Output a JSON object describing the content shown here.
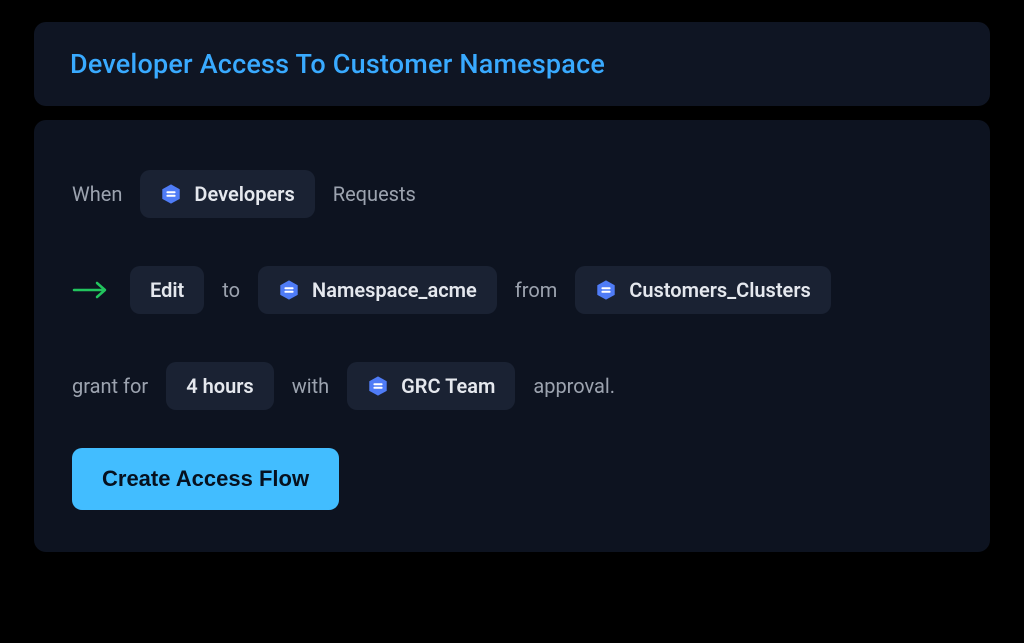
{
  "colors": {
    "accent": "#39aaff",
    "k8sBlue": "#4f7cf7",
    "green": "#22c55e",
    "button": "#42bdff"
  },
  "header": {
    "title": "Developer Access To Customer Namespace"
  },
  "flow": {
    "when_label": "When",
    "requester": "Developers",
    "requests_label": "Requests",
    "action": "Edit",
    "to_label": "to",
    "target_namespace": "Namespace_acme",
    "from_label": "from",
    "source_cluster": "Customers_Clusters",
    "grant_label": "grant for",
    "duration": "4 hours",
    "with_label": "with",
    "approver": "GRC Team",
    "approval_label": "approval."
  },
  "actions": {
    "create": "Create Access Flow"
  }
}
